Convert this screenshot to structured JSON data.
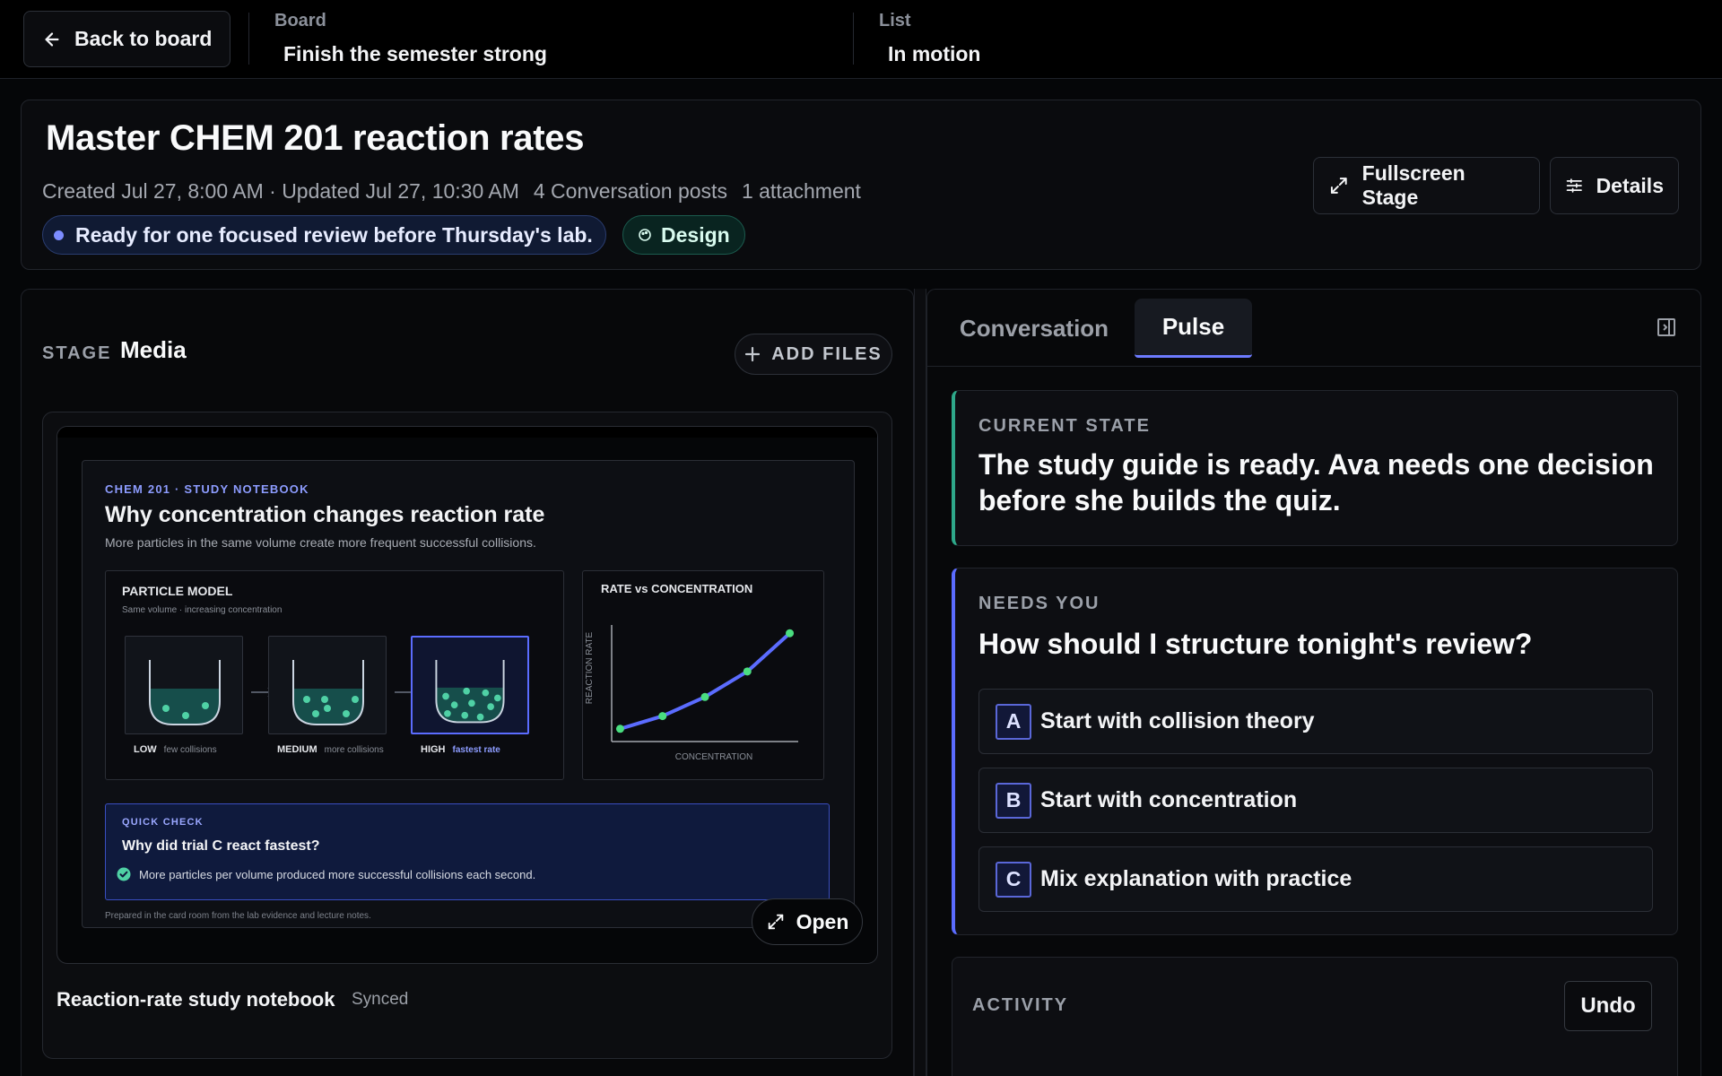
{
  "topbar": {
    "back_label": "Back to board",
    "board_key": "Board",
    "board_value": "Finish the semester strong",
    "list_key": "List",
    "list_value": "In motion"
  },
  "header": {
    "title": "Master CHEM 201 reaction rates",
    "created": "Created Jul 27, 8:00 AM · Updated Jul 27, 10:30 AM",
    "posts": "4 Conversation posts",
    "attachments": "1 attachment",
    "status_text": "Ready for one focused review before Thursday's lab.",
    "tag_label": "Design",
    "fullscreen_label": "Fullscreen Stage",
    "details_label": "Details"
  },
  "stage": {
    "label": "STAGE",
    "media_label": "Media",
    "add_files_label": "ADD FILES",
    "file_name": "Reaction-rate study notebook",
    "file_status": "Synced",
    "open_label": "Open",
    "notebook": {
      "kicker": "CHEM 201 · STUDY NOTEBOOK",
      "title": "Why concentration changes reaction rate",
      "subtitle": "More particles in the same volume create more frequent successful collisions.",
      "particle_title": "PARTICLE MODEL",
      "particle_sub": "Same volume · increasing concentration",
      "beakers": [
        {
          "level": "LOW",
          "note": "few collisions",
          "particles": 3
        },
        {
          "level": "MEDIUM",
          "note": "more collisions",
          "particles": 6
        },
        {
          "level": "HIGH",
          "note": "fastest rate",
          "particles": 10
        }
      ],
      "quick_check_kicker": "QUICK CHECK",
      "quick_check_question": "Why did trial C react fastest?",
      "quick_check_answer": "More particles per volume produced more successful collisions each second.",
      "footer": "Prepared in the card room from the lab evidence and lecture notes."
    }
  },
  "chart_data": {
    "type": "line",
    "title": "RATE vs CONCENTRATION",
    "xlabel": "CONCENTRATION",
    "ylabel": "REACTION RATE",
    "x": [
      1,
      2,
      3,
      4,
      5
    ],
    "values": [
      1.0,
      2.0,
      3.5,
      5.5,
      8.5
    ],
    "xlim": [
      0.8,
      5.2
    ],
    "ylim": [
      0,
      9.5
    ],
    "grid": false,
    "color": "#5b6cff",
    "marker_color": "#4ade80"
  },
  "pulse": {
    "tabs": [
      {
        "label": "Conversation",
        "active": false
      },
      {
        "label": "Pulse",
        "active": true
      }
    ],
    "current_state_key": "CURRENT STATE",
    "current_state_text": "The study guide is ready. Ava needs one decision before she builds the quiz.",
    "needs_you_key": "NEEDS YOU",
    "question": "How should I structure tonight's review?",
    "options": [
      {
        "letter": "A",
        "text": "Start with collision theory"
      },
      {
        "letter": "B",
        "text": "Start with concentration"
      },
      {
        "letter": "C",
        "text": "Mix explanation with practice"
      }
    ],
    "activity_key": "ACTIVITY",
    "undo_label": "Undo"
  },
  "colors": {
    "accent": "#5b6cff",
    "teal": "#2ea88a",
    "particle": "#4fd1a5"
  }
}
